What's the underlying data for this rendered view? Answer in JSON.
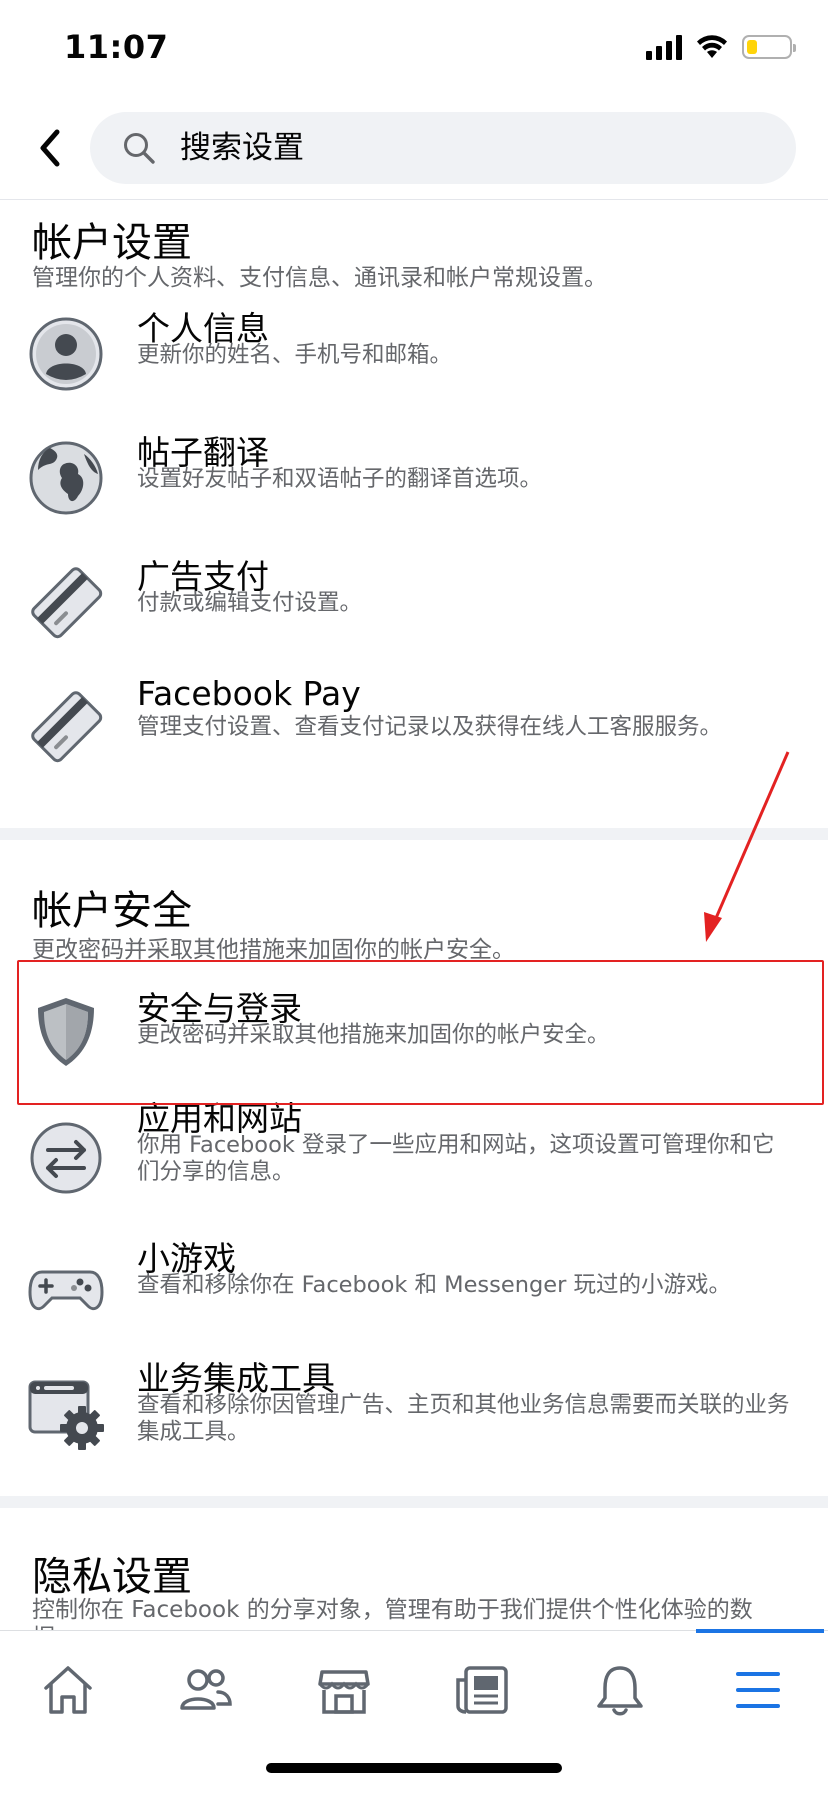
{
  "status_bar": {
    "time": "11:07"
  },
  "search": {
    "placeholder": "搜索设置"
  },
  "sections": [
    {
      "title": "帐户设置",
      "subtitle": "管理你的个人资料、支付信息、通讯录和帐户常规设置。",
      "items": [
        {
          "icon": "person-icon",
          "title": "个人信息",
          "desc": "更新你的姓名、手机号和邮箱。"
        },
        {
          "icon": "globe-icon",
          "title": "帖子翻译",
          "desc": "设置好友帖子和双语帖子的翻译首选项。"
        },
        {
          "icon": "credit-card-icon",
          "title": "广告支付",
          "desc": "付款或编辑支付设置。"
        },
        {
          "icon": "credit-card-icon",
          "title": "Facebook Pay",
          "desc": "管理支付设置、查看支付记录以及获得在线人工客服服务。"
        }
      ]
    },
    {
      "title": "帐户安全",
      "subtitle": "更改密码并采取其他措施来加固你的帐户安全。",
      "items": [
        {
          "icon": "shield-icon",
          "title": "安全与登录",
          "desc": "更改密码并采取其他措施来加固你的帐户安全。"
        },
        {
          "icon": "arrows-exchange-icon",
          "title": "应用和网站",
          "desc": "你用 Facebook 登录了一些应用和网站，这项设置可管理你和它们分享的信息。"
        },
        {
          "icon": "gamepad-icon",
          "title": "小游戏",
          "desc": "查看和移除你在 Facebook 和 Messenger 玩过的小游戏。"
        },
        {
          "icon": "browser-gear-icon",
          "title": "业务集成工具",
          "desc": "查看和移除你因管理广告、主页和其他业务信息需要而关联的业务集成工具。"
        }
      ]
    },
    {
      "title": "隐私设置",
      "subtitle": "控制你在 Facebook 的分享对象，管理有助于我们提供个性化体验的数据。"
    }
  ],
  "tabs": [
    {
      "icon": "home-icon"
    },
    {
      "icon": "friends-icon"
    },
    {
      "icon": "marketplace-icon"
    },
    {
      "icon": "news-icon"
    },
    {
      "icon": "bell-icon"
    },
    {
      "icon": "menu-icon",
      "active": true
    }
  ],
  "colors": {
    "accent": "#1b74e4",
    "highlight": "#e32222",
    "secondary_text": "#65676b",
    "divider": "#f0f2f5"
  }
}
